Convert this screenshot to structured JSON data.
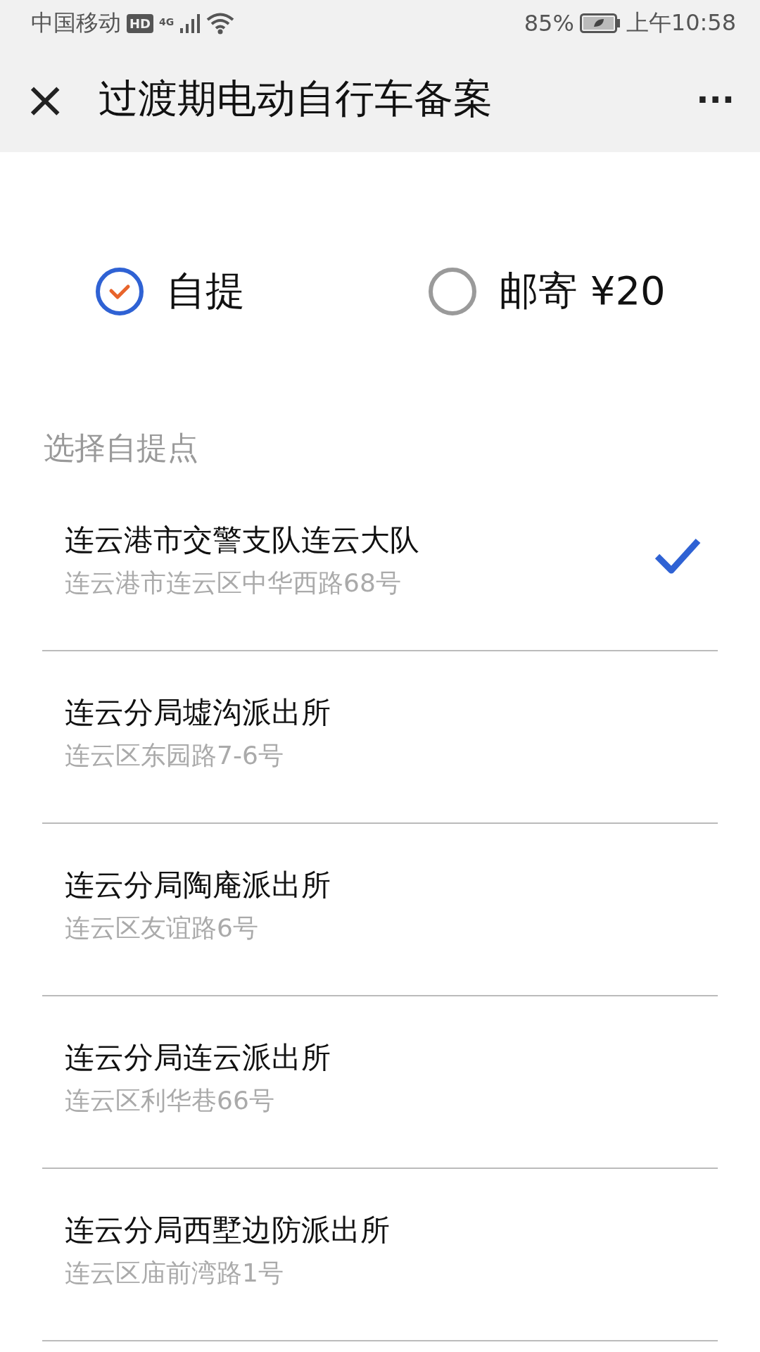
{
  "status_bar": {
    "carrier": "中国移动",
    "hd_badge": "HD",
    "network": "4G",
    "battery_percent": "85%",
    "time": "上午10:58"
  },
  "title_bar": {
    "close": "×",
    "title": "过渡期电动自行车备案",
    "more": "···"
  },
  "delivery_options": [
    {
      "label": "自提",
      "selected": true
    },
    {
      "label": "邮寄 ¥20",
      "selected": false
    }
  ],
  "section_label": "选择自提点",
  "pickup_points": [
    {
      "name": "连云港市交警支队连云大队",
      "address": "连云港市连云区中华西路68号",
      "selected": true
    },
    {
      "name": "连云分局墟沟派出所",
      "address": "连云区东园路7-6号",
      "selected": false
    },
    {
      "name": "连云分局陶庵派出所",
      "address": "连云区友谊路6号",
      "selected": false
    },
    {
      "name": "连云分局连云派出所",
      "address": "连云区利华巷66号",
      "selected": false
    },
    {
      "name": "连云分局西墅边防派出所",
      "address": "连云区庙前湾路1号",
      "selected": false
    }
  ]
}
